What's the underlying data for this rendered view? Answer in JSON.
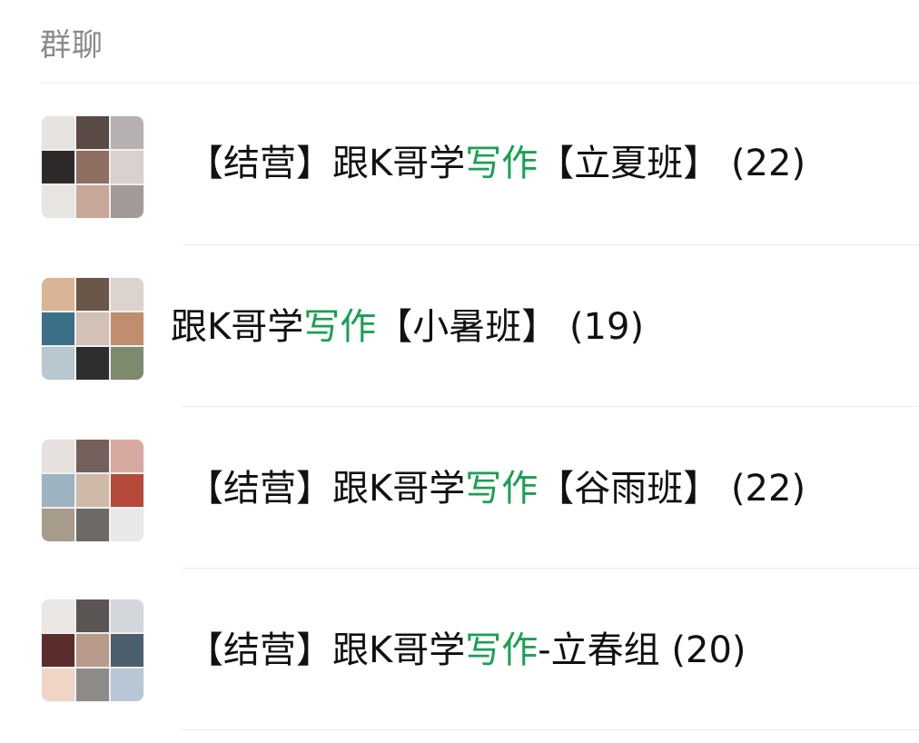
{
  "section": {
    "title": "群聊"
  },
  "groups": [
    {
      "prefix": "【结营】跟K哥学",
      "highlight": "写作",
      "suffix": "【立夏班】",
      "count": "(22)",
      "tiles": [
        "#e7e3e1",
        "#5a4a45",
        "#b7b0b0",
        "#2e2a2a",
        "#8f6f61",
        "#d9d1cd",
        "#e8e4e2",
        "#c7a898",
        "#a39a98"
      ]
    },
    {
      "prefix": "跟K哥学",
      "highlight": "写作",
      "suffix": "【小暑班】",
      "count": "(19)",
      "tiles": [
        "#d9b497",
        "#6a5549",
        "#dcd3cf",
        "#3b6f88",
        "#d2c1b5",
        "#c08e6d",
        "#b9c7cf",
        "#2e2e2e",
        "#7e8a6d"
      ]
    },
    {
      "prefix": "【结营】跟K哥学",
      "highlight": "写作",
      "suffix": "【谷雨班】",
      "count": "(22)",
      "tiles": [
        "#e6e1df",
        "#74615b",
        "#d7a9a0",
        "#9db3c2",
        "#cfb9a8",
        "#b54a3b",
        "#a79b8c",
        "#6d6a66",
        "#e8e8e8"
      ]
    },
    {
      "prefix": "【结营】跟K哥学",
      "highlight": "写作",
      "suffix": "-立春组",
      "count": "(20)",
      "tiles": [
        "#ebe7e5",
        "#5a5553",
        "#d3d6da",
        "#5b2d2d",
        "#b89b8a",
        "#4d5e6f",
        "#f0d5c6",
        "#8f8b88",
        "#b8c6d6"
      ]
    }
  ]
}
